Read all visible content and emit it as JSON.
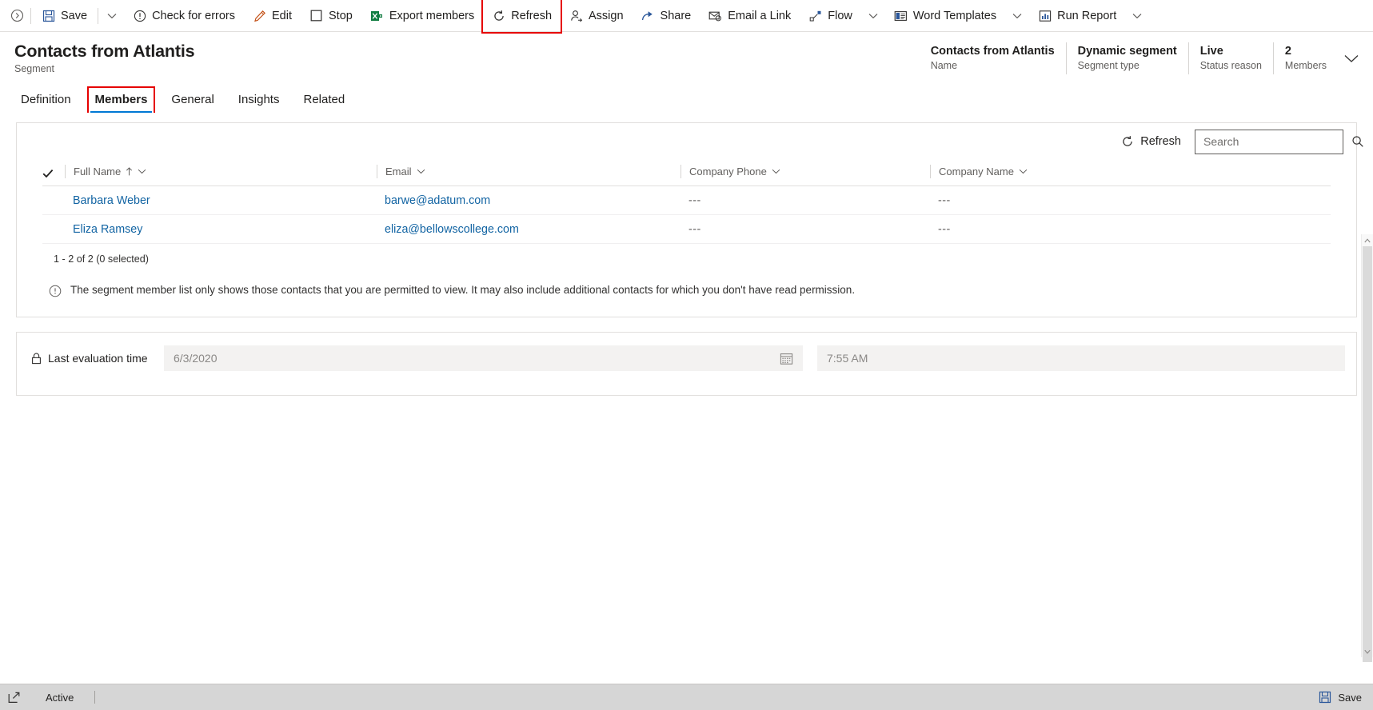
{
  "commandbar": {
    "back_icon": "chevron-circle-icon",
    "items": [
      {
        "id": "save",
        "label": "Save",
        "icon": "save-icon",
        "chevron": true
      },
      {
        "id": "check-for-errors",
        "label": "Check for errors",
        "icon": "alert-circle-icon",
        "chevron": false
      },
      {
        "id": "edit",
        "label": "Edit",
        "icon": "pencil-icon",
        "chevron": false
      },
      {
        "id": "stop",
        "label": "Stop",
        "icon": "square-icon",
        "chevron": false
      },
      {
        "id": "export-members",
        "label": "Export members",
        "icon": "excel-icon",
        "chevron": false
      },
      {
        "id": "refresh",
        "label": "Refresh",
        "icon": "refresh-icon",
        "chevron": false,
        "highlighted": true
      },
      {
        "id": "assign",
        "label": "Assign",
        "icon": "assign-person-icon",
        "chevron": false
      },
      {
        "id": "share",
        "label": "Share",
        "icon": "share-icon",
        "chevron": false
      },
      {
        "id": "email-a-link",
        "label": "Email a Link",
        "icon": "email-link-icon",
        "chevron": false
      },
      {
        "id": "flow",
        "label": "Flow",
        "icon": "flow-icon",
        "chevron": true
      },
      {
        "id": "word-templates",
        "label": "Word Templates",
        "icon": "word-template-icon",
        "chevron": true
      },
      {
        "id": "run-report",
        "label": "Run Report",
        "icon": "report-icon",
        "chevron": true
      }
    ]
  },
  "record": {
    "title": "Contacts from Atlantis",
    "subtitle": "Segment",
    "header_fields": [
      {
        "value": "Contacts from Atlantis",
        "label": "Name"
      },
      {
        "value": "Dynamic segment",
        "label": "Segment type"
      },
      {
        "value": "Live",
        "label": "Status reason"
      },
      {
        "value": "2",
        "label": "Members"
      }
    ],
    "expand_icon": "chevron-down-icon"
  },
  "tabs": [
    {
      "id": "definition",
      "label": "Definition",
      "active": false,
      "highlighted": false
    },
    {
      "id": "members",
      "label": "Members",
      "active": true,
      "highlighted": true
    },
    {
      "id": "general",
      "label": "General",
      "active": false,
      "highlighted": false
    },
    {
      "id": "insights",
      "label": "Insights",
      "active": false,
      "highlighted": false
    },
    {
      "id": "related",
      "label": "Related",
      "active": false,
      "highlighted": false
    }
  ],
  "grid": {
    "refresh_label": "Refresh",
    "refresh_icon": "refresh-icon",
    "search_placeholder": "Search",
    "search_value": "",
    "search_icon": "magnifier-icon",
    "select_all_icon": "checkmark-icon",
    "columns": [
      {
        "id": "full-name",
        "label": "Full Name",
        "sorted": true,
        "sort_icon": "arrow-up-icon"
      },
      {
        "id": "email",
        "label": "Email",
        "sorted": false
      },
      {
        "id": "company-phone",
        "label": "Company Phone",
        "sorted": false
      },
      {
        "id": "company-name",
        "label": "Company Name",
        "sorted": false
      }
    ],
    "rows": [
      {
        "full_name": "Barbara Weber",
        "email": "barwe@adatum.com",
        "company_phone": "---",
        "company_name": "---"
      },
      {
        "full_name": "Eliza Ramsey",
        "email": "eliza@bellowscollege.com",
        "company_phone": "---",
        "company_name": "---"
      }
    ],
    "row_count_text": "1 - 2 of 2 (0 selected)",
    "notice_icon": "info-circle-icon",
    "notice_text": "The segment member list only shows those contacts that you are permitted to view. It may also include additional contacts for which you don't have read permission."
  },
  "fields": {
    "last_evaluation": {
      "lock_icon": "lock-icon",
      "label": "Last evaluation time",
      "date_value": "6/3/2020",
      "date_icon": "calendar-icon",
      "time_value": "7:55 AM"
    }
  },
  "statusbar": {
    "expand_icon": "popout-icon",
    "state_label": "Active",
    "save_label": "Save",
    "save_icon": "save-icon"
  },
  "colors": {
    "accent": "#0078d4",
    "link": "#1264a3",
    "highlight_box": "#e60000",
    "excel_green": "#107c41",
    "statusbar_bg": "#d6d6d6"
  }
}
